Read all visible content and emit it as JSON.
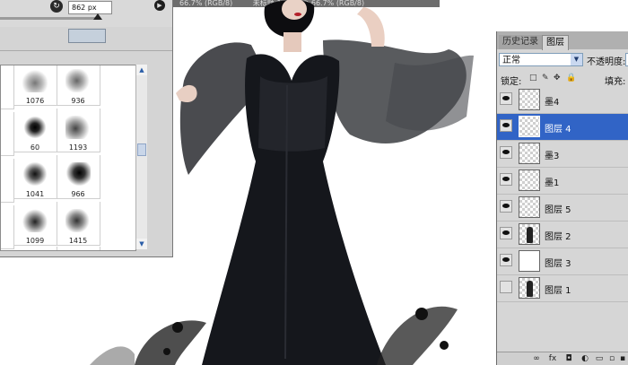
{
  "document": {
    "tabs": [
      "66.7% (RGB/8)",
      "未标题-1",
      "@ 66.7% (RGB/8)"
    ]
  },
  "brush_panel": {
    "size_value": "862 px",
    "presets": [
      {
        "number": "1076"
      },
      {
        "number": "936"
      },
      {
        "number": "60"
      },
      {
        "number": "1193"
      },
      {
        "number": "1041"
      },
      {
        "number": "966"
      },
      {
        "number": "1099"
      },
      {
        "number": "1415"
      },
      {
        "number": ""
      },
      {
        "number": ""
      }
    ]
  },
  "layers_panel": {
    "tabs": {
      "history": "历史记录",
      "layers": "图层"
    },
    "blend_mode": "正常",
    "opacity_label": "不透明度:",
    "lock_label": "锁定:",
    "fill_label": "填充:",
    "layers": [
      {
        "name": "墨4",
        "visible": true,
        "selected": false
      },
      {
        "name": "图层 4",
        "visible": true,
        "selected": true
      },
      {
        "name": "墨3",
        "visible": true,
        "selected": false
      },
      {
        "name": "墨1",
        "visible": true,
        "selected": false
      },
      {
        "name": "图层 5",
        "visible": true,
        "selected": false
      },
      {
        "name": "图层 2",
        "visible": true,
        "selected": false
      },
      {
        "name": "图层 3",
        "visible": true,
        "selected": false
      },
      {
        "name": "图层 1",
        "visible": false,
        "selected": false
      }
    ]
  },
  "colors": {
    "selection": "#3164c6",
    "panel_bg": "#d6d6d6",
    "dress": "#15171c"
  }
}
